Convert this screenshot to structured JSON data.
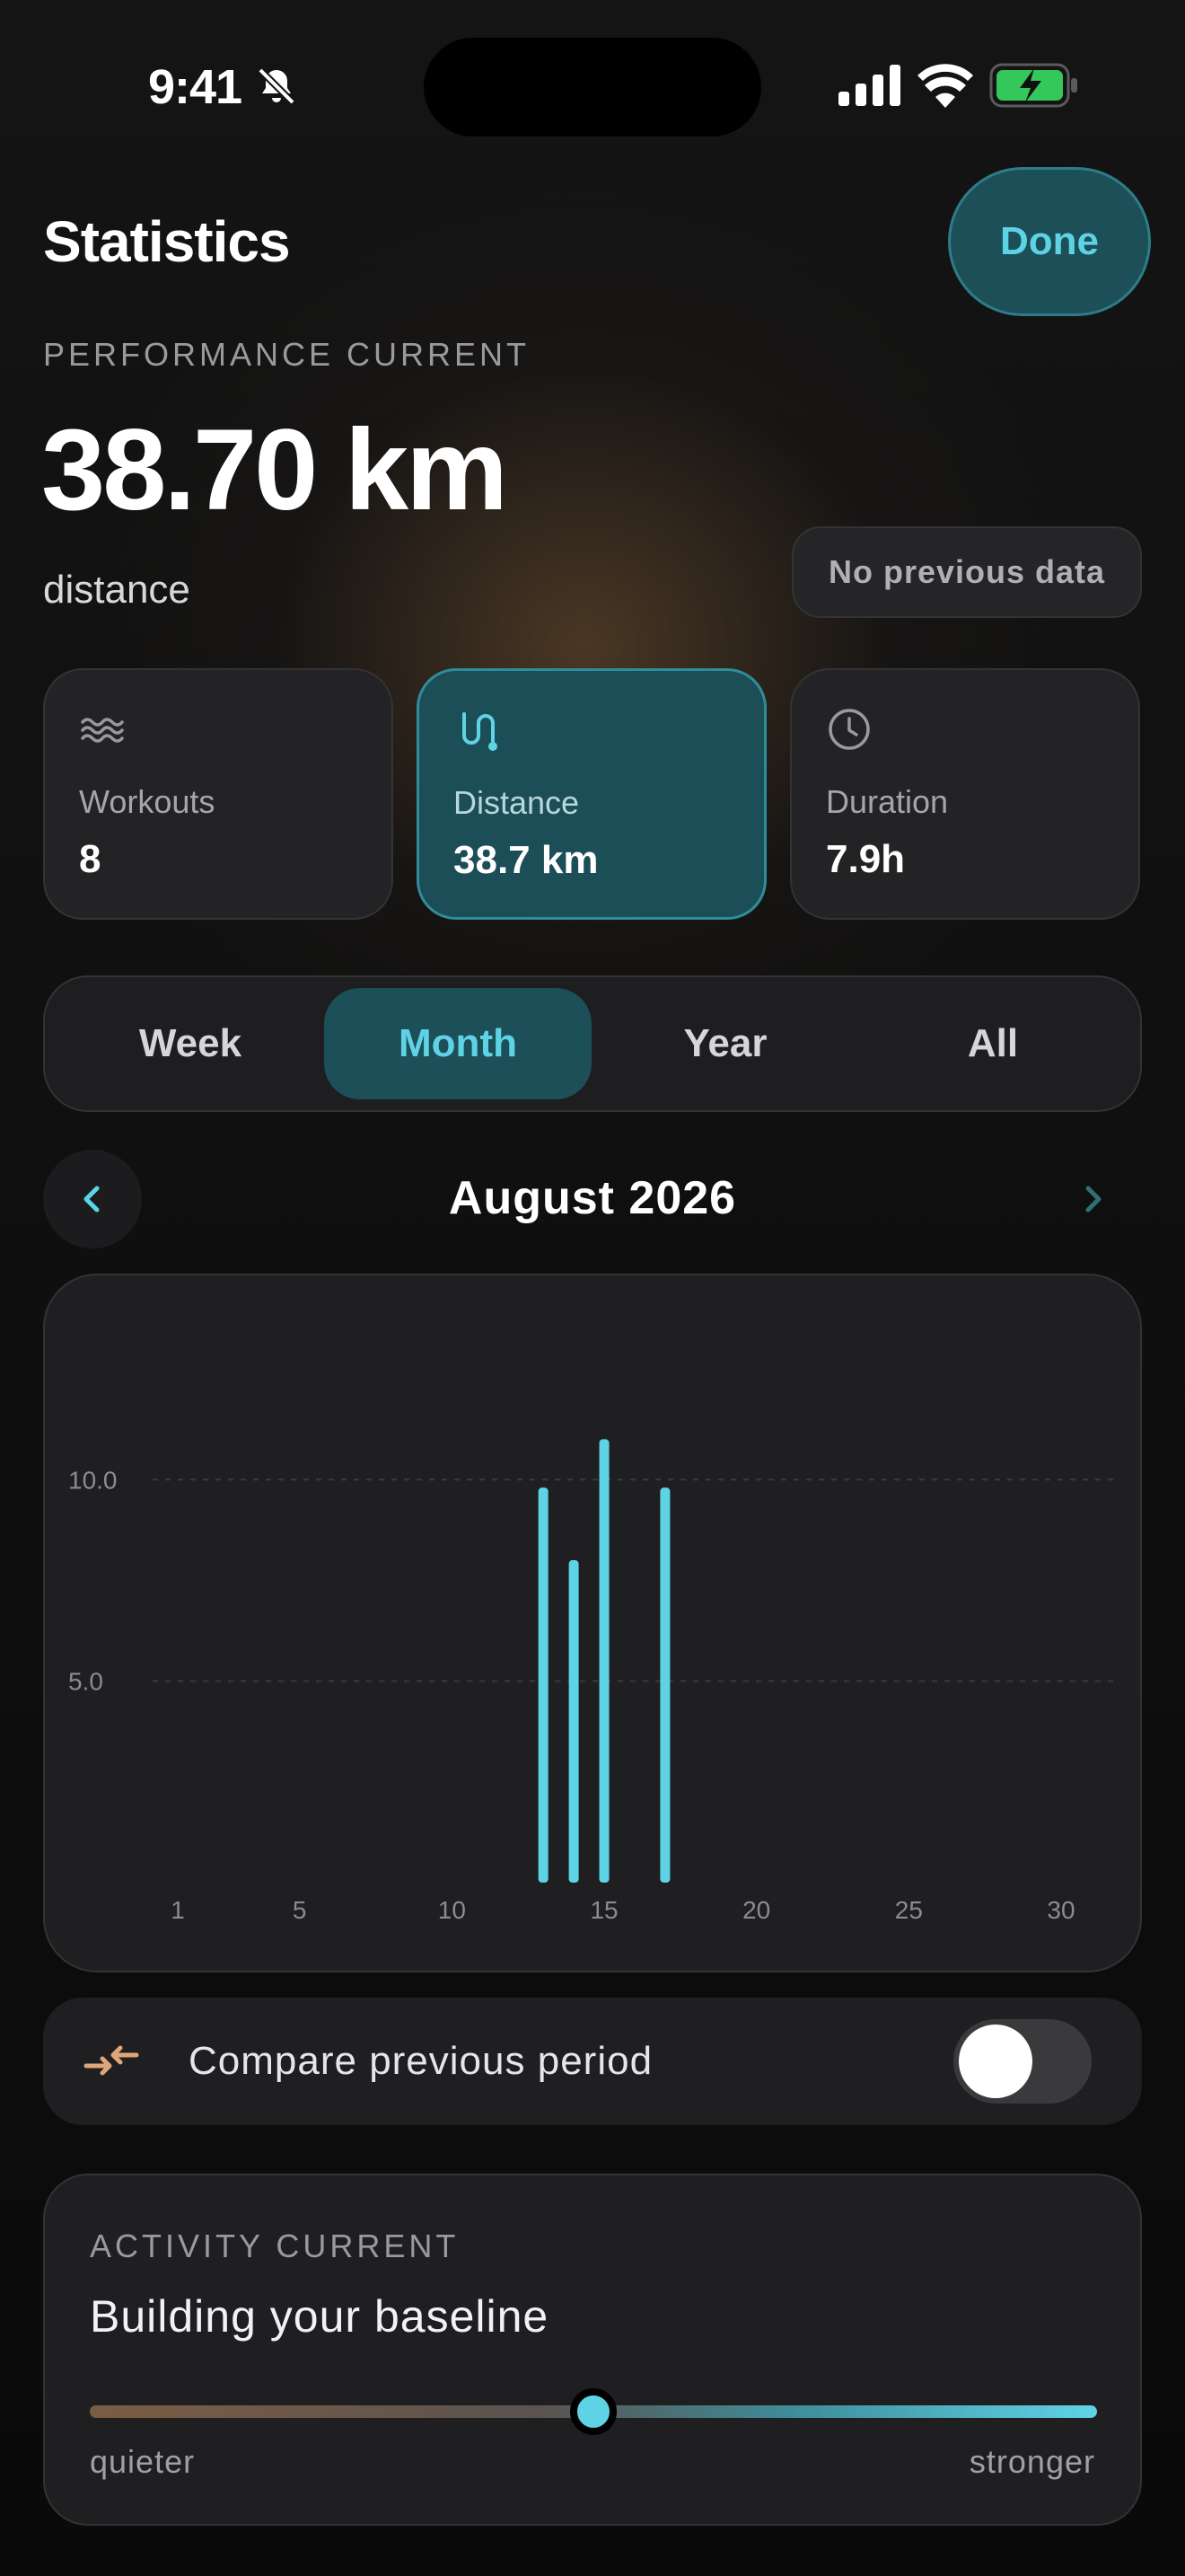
{
  "status_bar": {
    "time": "9:41"
  },
  "header": {
    "title": "Statistics",
    "done_label": "Done"
  },
  "performance": {
    "section_label": "PERFORMANCE CURRENT",
    "value": "38.70 km",
    "metric": "distance",
    "comparison_badge": "No previous data"
  },
  "cards": [
    {
      "label": "Workouts",
      "value": "8",
      "icon": "waves-icon",
      "active": false
    },
    {
      "label": "Distance",
      "value": "38.7 km",
      "icon": "route-icon",
      "active": true
    },
    {
      "label": "Duration",
      "value": "7.9h",
      "icon": "clock-icon",
      "active": false
    }
  ],
  "periods": [
    {
      "label": "Week",
      "active": false
    },
    {
      "label": "Month",
      "active": true
    },
    {
      "label": "Year",
      "active": false
    },
    {
      "label": "All",
      "active": false
    }
  ],
  "month_nav": {
    "title": "August 2026"
  },
  "chart_data": {
    "type": "bar",
    "x_ticks": [
      "1",
      "5",
      "10",
      "15",
      "20",
      "25",
      "30"
    ],
    "y_ticks": [
      "10.0",
      "5.0"
    ],
    "x": [
      13,
      14,
      15,
      17
    ],
    "values": [
      9.8,
      8.0,
      11.0,
      9.8
    ],
    "xlim": [
      1,
      30
    ],
    "ylim": [
      0,
      11.5
    ],
    "grid": true,
    "color": "#5fd3e6"
  },
  "compare": {
    "label": "Compare previous period",
    "enabled": false
  },
  "activity": {
    "section_label": "ACTIVITY CURRENT",
    "title": "Building your baseline",
    "min_label": "quieter",
    "max_label": "stronger",
    "level": 0.5
  },
  "colors": {
    "accent": "#5fd3e6",
    "accent_bg": "#1d4f58",
    "compare_icon": "#e0a67a"
  }
}
